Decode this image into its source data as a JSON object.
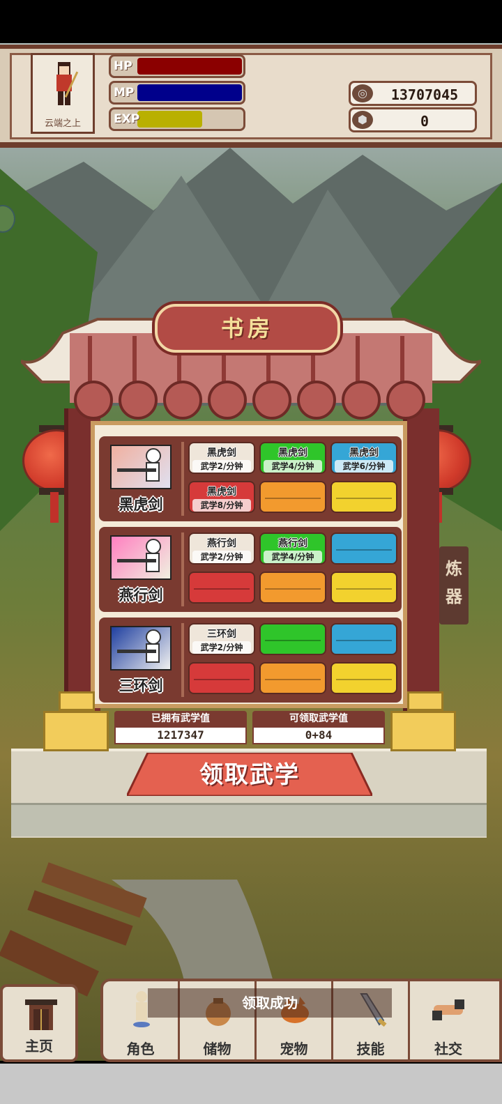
{
  "player": {
    "name": "云端之上",
    "hp_label": "HP",
    "mp_label": "MP",
    "exp_label": "EXP",
    "hp_fill": 1.0,
    "mp_fill": 1.0,
    "exp_fill": 0.62,
    "hp_color": "#8b0000",
    "mp_color": "#00008b",
    "exp_color": "#b9b000"
  },
  "currency": {
    "coins": "13707045",
    "gems": "0"
  },
  "study": {
    "title": "书房",
    "rows": [
      {
        "name": "黑虎剑",
        "icon": "black-tiger-sword-icon",
        "tiles": [
          {
            "title": "黑虎剑",
            "rate": "武学2/分钟",
            "color": "#efe6da"
          },
          {
            "title": "黑虎剑",
            "rate": "武学4/分钟",
            "color": "#2fc52a"
          },
          {
            "title": "黑虎剑",
            "rate": "武学6/分钟",
            "color": "#35a6d6"
          },
          {
            "title": "黑虎剑",
            "rate": "武学8/分钟",
            "color": "#d63a3a"
          },
          {
            "title": "",
            "rate": "",
            "color": "#f29a2e"
          },
          {
            "title": "",
            "rate": "",
            "color": "#f2d22e"
          }
        ]
      },
      {
        "name": "燕行剑",
        "icon": "swallow-sword-icon",
        "tiles": [
          {
            "title": "燕行剑",
            "rate": "武学2/分钟",
            "color": "#efe6da"
          },
          {
            "title": "燕行剑",
            "rate": "武学4/分钟",
            "color": "#2fc52a"
          },
          {
            "title": "",
            "rate": "",
            "color": "#35a6d6"
          },
          {
            "title": "",
            "rate": "",
            "color": "#d63a3a"
          },
          {
            "title": "",
            "rate": "",
            "color": "#f29a2e"
          },
          {
            "title": "",
            "rate": "",
            "color": "#f2d22e"
          }
        ]
      },
      {
        "name": "三环剑",
        "icon": "three-ring-sword-icon",
        "tiles": [
          {
            "title": "三环剑",
            "rate": "武学2/分钟",
            "color": "#efe6da"
          },
          {
            "title": "",
            "rate": "",
            "color": "#2fc52a"
          },
          {
            "title": "",
            "rate": "",
            "color": "#35a6d6"
          },
          {
            "title": "",
            "rate": "",
            "color": "#d63a3a"
          },
          {
            "title": "",
            "rate": "",
            "color": "#f29a2e"
          },
          {
            "title": "",
            "rate": "",
            "color": "#f2d22e"
          }
        ]
      }
    ],
    "owned_label": "已拥有武学值",
    "owned_value": "1217347",
    "claimable_label": "可领取武学值",
    "claimable_value": "0+84",
    "claim_button": "领取武学"
  },
  "side_tab": {
    "line1": "炼",
    "line2": "器"
  },
  "toast": "领取成功",
  "nav": {
    "home": "主页",
    "items": [
      "角色",
      "储物",
      "宠物",
      "技能",
      "社交"
    ]
  }
}
